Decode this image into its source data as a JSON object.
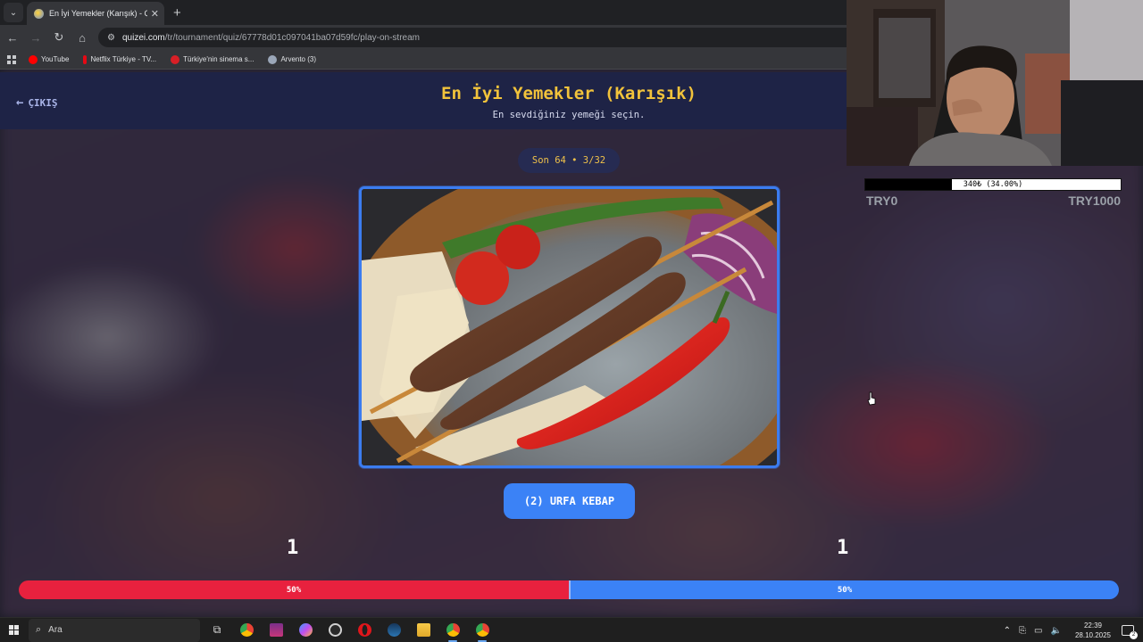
{
  "browser": {
    "tab_title": "En İyi Yemekler (Karışık) - Quize",
    "tab_close": "✕",
    "new_tab": "+",
    "url_domain": "quizei.com",
    "url_path": "/tr/tournament/quiz/67778d01c097041ba07d59fc/play-on-stream",
    "bookmarks": [
      {
        "label": "YouTube",
        "color": "#ff0000"
      },
      {
        "label": "Netflix Türkiye - TV...",
        "color": "#e50914"
      },
      {
        "label": "Türkiye'nin sinema s...",
        "color": "#d81f26"
      },
      {
        "label": "Arvento (3)",
        "color": "#9aa6b8"
      }
    ]
  },
  "quiz": {
    "exit_label": "ÇIKIŞ",
    "exit_arrow": "←",
    "title": "En İyi Yemekler (Karışık)",
    "subtitle": "En sevdiğiniz yemeği seçin.",
    "round_label": "Son 64 • 3/32",
    "choice_label": "(2) URFA KEBAP",
    "votes_left": "1",
    "votes_right": "1",
    "bar_left_label": "50%",
    "bar_right_label": "50%",
    "bar_left_fraction": 0.5,
    "colors": {
      "accent_blue": "#3b82f6",
      "accent_red": "#e8213e",
      "title_gold": "#f2c33b"
    }
  },
  "donation": {
    "label": "340₺ (34.00%)",
    "fraction": 0.34,
    "min_label": "TRY0",
    "max_label": "TRY1000"
  },
  "taskbar": {
    "search_placeholder": "Ara",
    "time": "22:39",
    "date": "28.10.2025",
    "notifications": "2"
  }
}
